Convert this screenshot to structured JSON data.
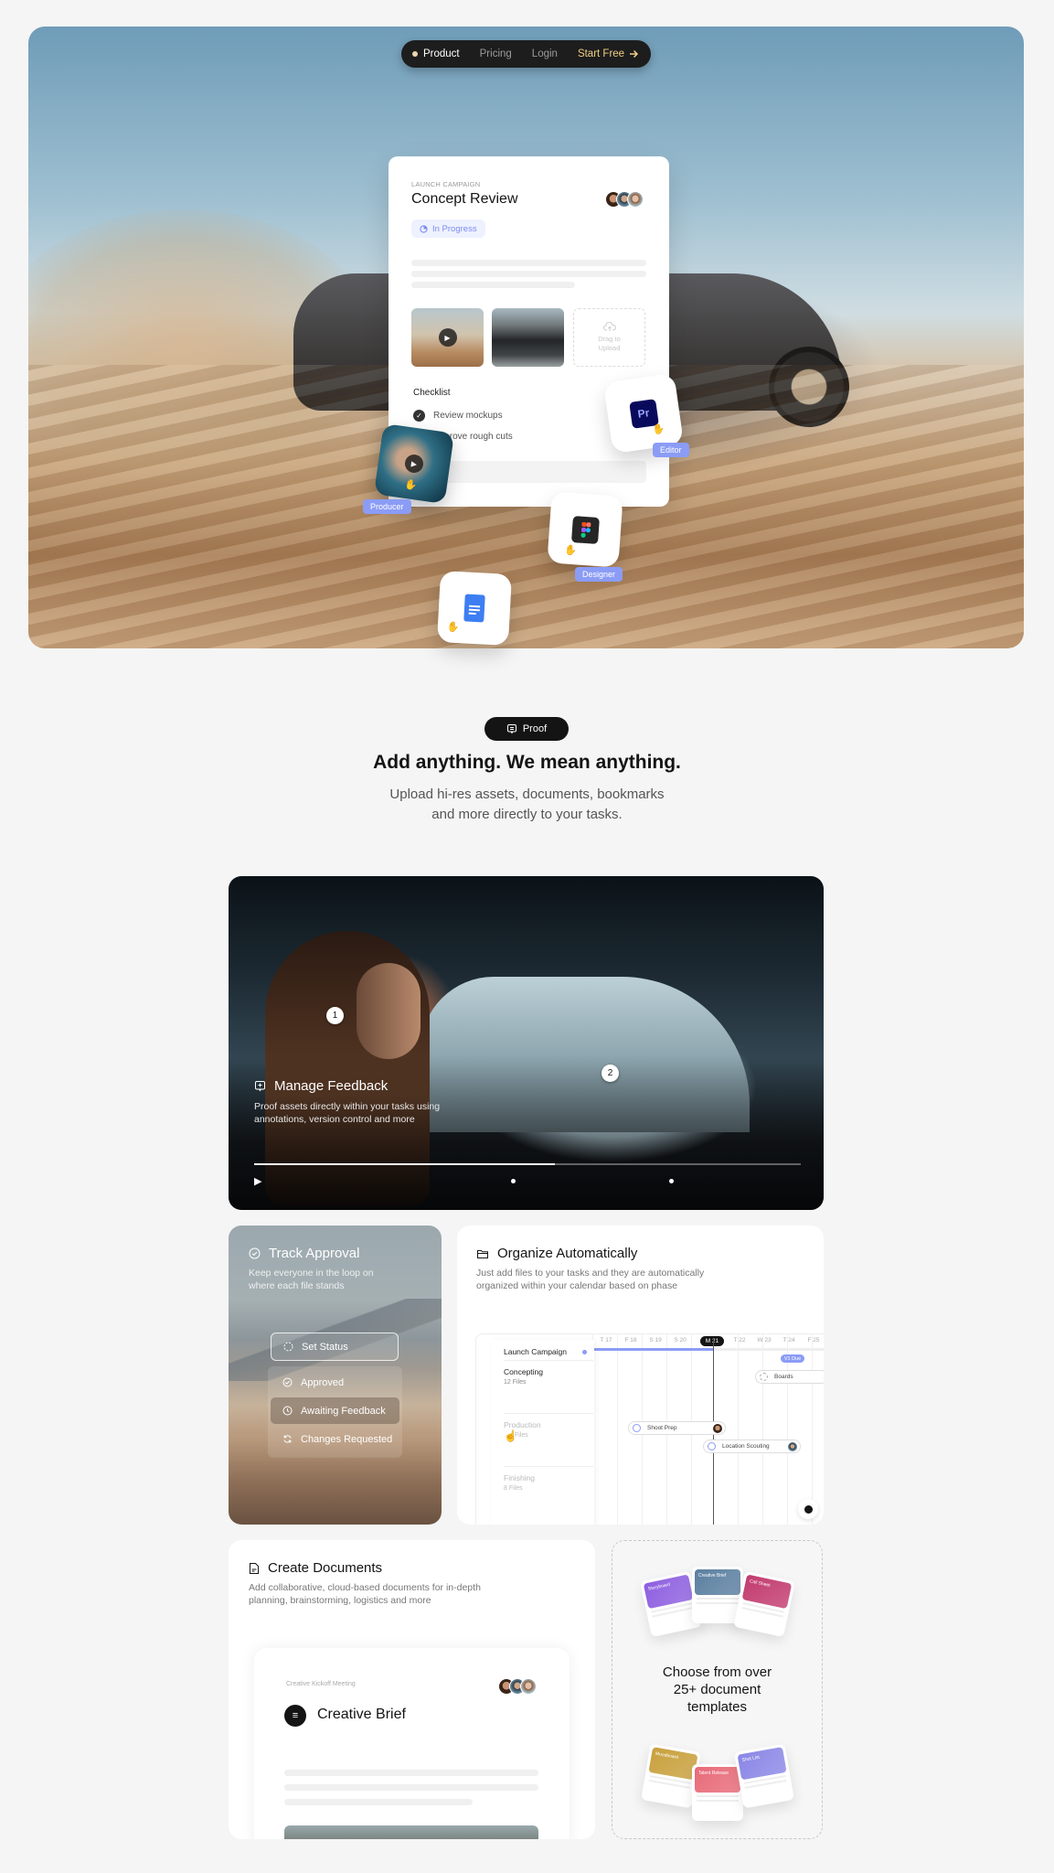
{
  "nav": {
    "items": [
      "Product",
      "Pricing",
      "Login"
    ],
    "active": "Product",
    "cta": "Start Free",
    "cta_icon": "arrow-right-icon"
  },
  "hero_task_card": {
    "eyebrow": "LAUNCH CAMPAIGN",
    "title": "Concept Review",
    "status": "In Progress",
    "upload_text_1": "Drag to",
    "upload_text_2": "Upload",
    "checklist_title": "Checklist",
    "checklist": [
      {
        "label": "Review mockups",
        "done": true
      },
      {
        "label": "Approve rough cuts",
        "done": false
      }
    ]
  },
  "floating_roles": [
    {
      "label": "Editor",
      "app": "Premiere Pro",
      "logo_text": "Pr"
    },
    {
      "label": "Producer",
      "app": "Video"
    },
    {
      "label": "Designer",
      "app": "Figma"
    },
    {
      "label": "",
      "app": "Google Docs"
    }
  ],
  "section": {
    "badge": "Proof",
    "heading": "Add anything. We mean anything.",
    "sub_1": "Upload hi-res assets, documents, bookmarks",
    "sub_2": "and more directly to your tasks."
  },
  "feedback": {
    "title": "Manage Feedback",
    "desc": "Proof assets directly within your tasks using annotations, version control and more",
    "pins": [
      "1",
      "2"
    ],
    "progress": 0.55
  },
  "approval": {
    "title": "Track Approval",
    "desc": "Keep everyone in the loop on where each file stands",
    "set_status": "Set Status",
    "options": [
      "Approved",
      "Awaiting Feedback",
      "Changes Requested"
    ]
  },
  "organize": {
    "title": "Organize Automatically",
    "desc": "Just add files to your tasks and they are automatically organized within your calendar based on phase",
    "project": "Launch Campaign",
    "days": [
      "T 17",
      "F 18",
      "S 19",
      "S 20",
      "M 21",
      "T 22",
      "W 23",
      "T 24",
      "F 25"
    ],
    "today": "M 21",
    "phases": [
      {
        "name": "Concepting",
        "files": "12 Files"
      },
      {
        "name": "Production",
        "files": "Files"
      },
      {
        "name": "Finishing",
        "files": "8 Files"
      }
    ],
    "milestone": "V1 Due",
    "events": [
      "Boards",
      "Shoot Prep",
      "Location Scouting"
    ]
  },
  "documents": {
    "title": "Create Documents",
    "desc": "Add collaborative, cloud-based documents for in-depth planning, brainstorming, logistics and more",
    "doc_eyebrow": "Creative Kickoff Meeting",
    "doc_title": "Creative Brief"
  },
  "templates": {
    "text_1": "Choose from over",
    "text_2": "25+ document",
    "text_3": "templates",
    "items": [
      "Storyboard",
      "Creative Brief",
      "Call Sheet",
      "Moodboard",
      "Talent Release",
      "Shot List"
    ],
    "colors": [
      "#8e5fe0",
      "#5b7fa0",
      "#c23a6e",
      "#c8a03c",
      "#e86a78",
      "#8a86e6"
    ]
  }
}
